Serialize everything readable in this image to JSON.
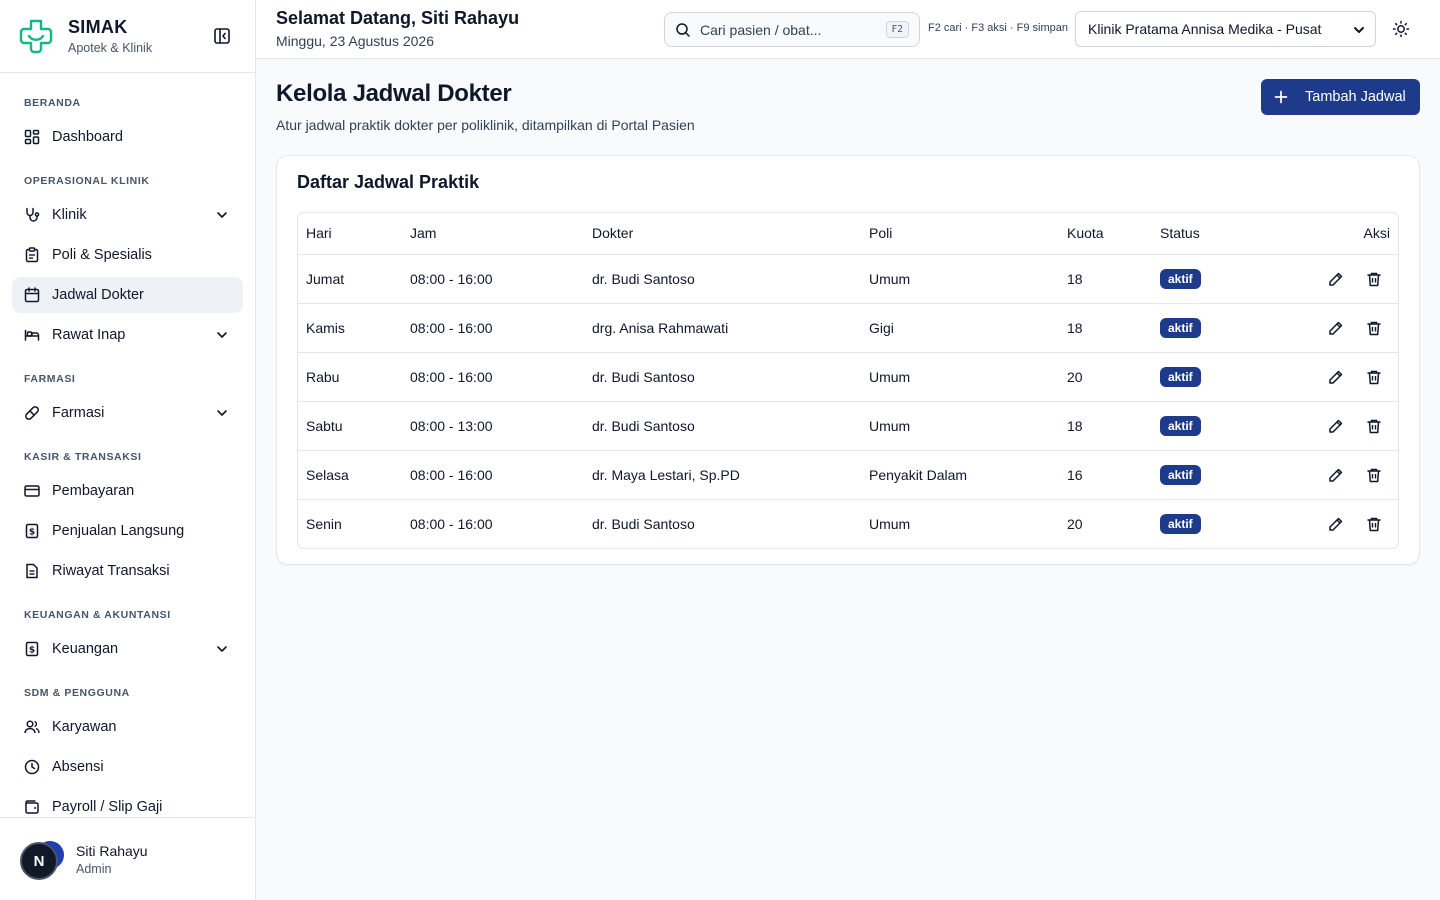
{
  "brand": {
    "name": "SIMAK",
    "subtitle": "Apotek & Klinik"
  },
  "sidebar": {
    "sections": [
      {
        "title": "BERANDA",
        "items": [
          {
            "label": "Dashboard",
            "icon": "dashboard-icon"
          }
        ]
      },
      {
        "title": "OPERASIONAL KLINIK",
        "items": [
          {
            "label": "Klinik",
            "icon": "stethoscope-icon",
            "expandable": true
          },
          {
            "label": "Poli & Spesialis",
            "icon": "clipboard-icon"
          },
          {
            "label": "Jadwal Dokter",
            "icon": "calendar-icon",
            "active": true
          },
          {
            "label": "Rawat Inap",
            "icon": "bed-icon",
            "expandable": true
          }
        ]
      },
      {
        "title": "FARMASI",
        "items": [
          {
            "label": "Farmasi",
            "icon": "pill-icon",
            "expandable": true
          }
        ]
      },
      {
        "title": "KASIR & TRANSAKSI",
        "items": [
          {
            "label": "Pembayaran",
            "icon": "credit-card-icon"
          },
          {
            "label": "Penjualan Langsung",
            "icon": "receipt-icon"
          },
          {
            "label": "Riwayat Transaksi",
            "icon": "file-text-icon"
          }
        ]
      },
      {
        "title": "KEUANGAN & AKUNTANSI",
        "items": [
          {
            "label": "Keuangan",
            "icon": "dollar-icon",
            "expandable": true
          }
        ]
      },
      {
        "title": "SDM & PENGGUNA",
        "items": [
          {
            "label": "Karyawan",
            "icon": "users-icon"
          },
          {
            "label": "Absensi",
            "icon": "clock-icon"
          },
          {
            "label": "Payroll / Slip Gaji",
            "icon": "wallet-icon"
          }
        ]
      }
    ]
  },
  "user": {
    "initial": "N",
    "name": "Siti Rahayu",
    "role": "Admin"
  },
  "header": {
    "welcome": "Selamat Datang, Siti Rahayu",
    "date": "Minggu, 23 Agustus 2026",
    "search_placeholder": "Cari pasien / obat...",
    "search_shortcut": "F2",
    "shortcuts": "F2 cari · F3 aksi · F9 simpan",
    "clinic": "Klinik Pratama Annisa Medika - Pusat"
  },
  "main": {
    "title": "Kelola Jadwal Dokter",
    "subtitle": "Atur jadwal praktik dokter per poliklinik, ditampilkan di Portal Pasien",
    "add_button": "Tambah Jadwal",
    "card_title": "Daftar Jadwal Praktik",
    "columns": [
      "Hari",
      "Jam",
      "Dokter",
      "Poli",
      "Kuota",
      "Status",
      "Aksi"
    ],
    "rows": [
      {
        "day": "Jumat",
        "time": "08:00 - 16:00",
        "doctor": "dr. Budi Santoso",
        "poli": "Umum",
        "quota": "18",
        "status": "aktif"
      },
      {
        "day": "Kamis",
        "time": "08:00 - 16:00",
        "doctor": "drg. Anisa Rahmawati",
        "poli": "Gigi",
        "quota": "18",
        "status": "aktif"
      },
      {
        "day": "Rabu",
        "time": "08:00 - 16:00",
        "doctor": "dr. Budi Santoso",
        "poli": "Umum",
        "quota": "20",
        "status": "aktif"
      },
      {
        "day": "Sabtu",
        "time": "08:00 - 13:00",
        "doctor": "dr. Budi Santoso",
        "poli": "Umum",
        "quota": "18",
        "status": "aktif"
      },
      {
        "day": "Selasa",
        "time": "08:00 - 16:00",
        "doctor": "dr. Maya Lestari, Sp.PD",
        "poli": "Penyakit Dalam",
        "quota": "16",
        "status": "aktif"
      },
      {
        "day": "Senin",
        "time": "08:00 - 16:00",
        "doctor": "dr. Budi Santoso",
        "poli": "Umum",
        "quota": "20",
        "status": "aktif"
      }
    ]
  },
  "colors": {
    "primary": "#1e3a8a",
    "brand_green": "#10b981",
    "active_bg": "#eef2f7"
  }
}
